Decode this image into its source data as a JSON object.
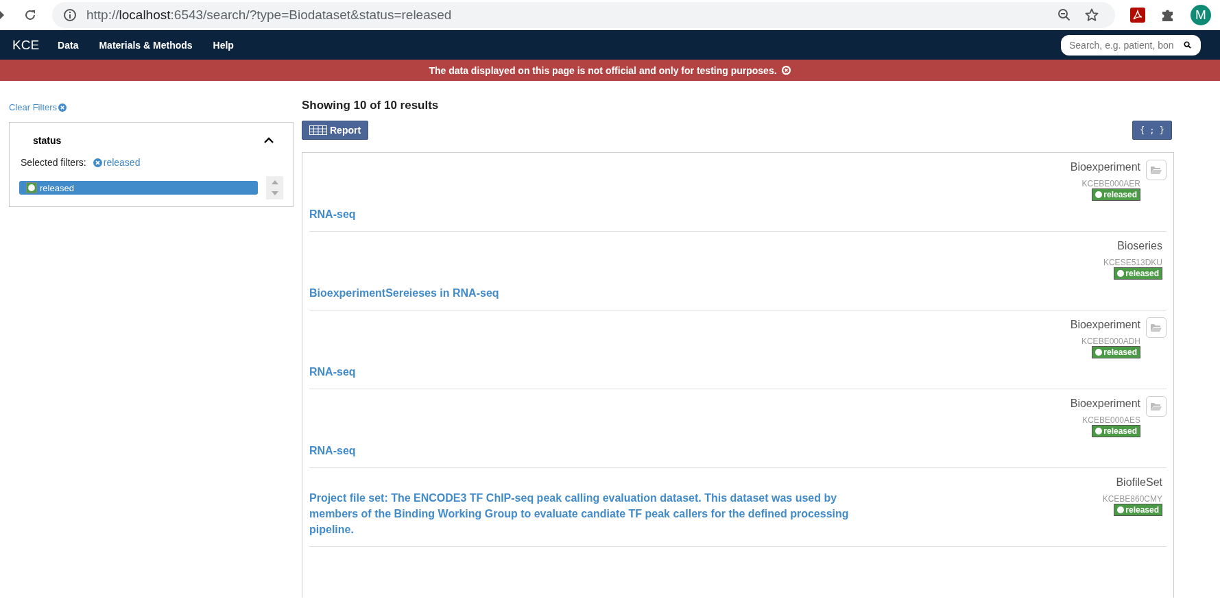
{
  "browser": {
    "url_host": "localhost",
    "url_rest_before": "http://",
    "url_rest_after": ":6543/search/?type=Biodataset&status=released",
    "profile_initial": "M"
  },
  "navbar": {
    "brand": "KCE",
    "items": [
      "Data",
      "Materials & Methods",
      "Help"
    ],
    "search": {
      "placeholder": "Search, e.g. patient, bon"
    }
  },
  "banner": {
    "text": "The data displayed on this page is not official and only for testing purposes."
  },
  "sidebar": {
    "clear_filters": "Clear Filters",
    "facet": {
      "title": "status",
      "expanded": true,
      "selected_label": "Selected filters:",
      "selected_filters": [
        "released"
      ],
      "terms": [
        {
          "label": "released",
          "selected": true
        }
      ]
    }
  },
  "results": {
    "summary": "Showing 10 of 10 results",
    "report_button": "Report",
    "json_button": "{ ; }",
    "items": [
      {
        "title": "RNA-seq",
        "type": "Bioexperiment",
        "accession": "KCEBE000AER",
        "status": "released",
        "folder_button": true
      },
      {
        "title": "BioexperimentSereieses in RNA-seq",
        "type": "Bioseries",
        "accession": "KCESE513DKU",
        "status": "released",
        "folder_button": false
      },
      {
        "title": "RNA-seq",
        "type": "Bioexperiment",
        "accession": "KCEBE000ADH",
        "status": "released",
        "folder_button": true
      },
      {
        "title": "RNA-seq",
        "type": "Bioexperiment",
        "accession": "KCEBE000AES",
        "status": "released",
        "folder_button": true
      },
      {
        "title": "Project file set: The ENCODE3 TF ChIP-seq peak calling evaluation dataset. This dataset was used by members of the Binding Working Group to evaluate candiate TF peak callers for the defined processing pipeline.",
        "type": "BiofileSet",
        "accession": "KCEBE860CMY",
        "status": "released",
        "folder_button": false
      }
    ]
  }
}
